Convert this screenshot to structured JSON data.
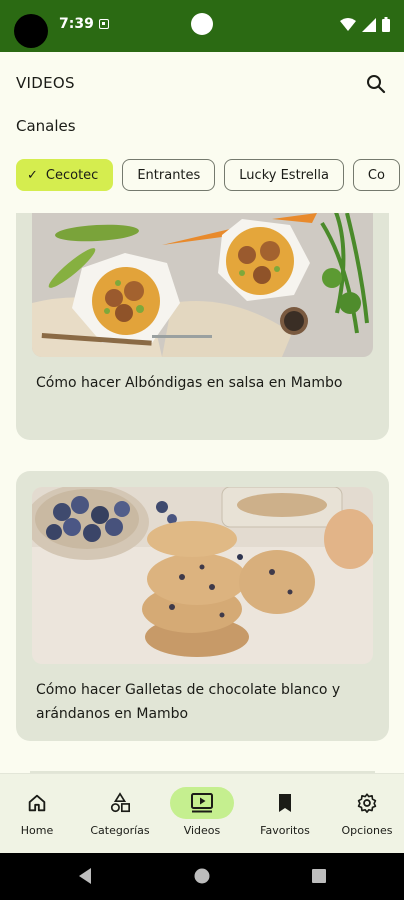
{
  "status_bar": {
    "time": "7:39"
  },
  "app_bar": {
    "title": "VIDEOS",
    "search_icon": "search-icon"
  },
  "channels": {
    "label": "Canales",
    "chips": [
      {
        "label": "Cecotec",
        "selected": true
      },
      {
        "label": "Entrantes",
        "selected": false
      },
      {
        "label": "Lucky Estrella",
        "selected": false
      },
      {
        "label": "Co",
        "selected": false
      }
    ]
  },
  "videos": [
    {
      "title": "Cómo hacer Albóndigas en salsa en Mambo"
    },
    {
      "title": "Cómo hacer Galletas de chocolate blanco y arándanos en Mambo"
    }
  ],
  "bottom_nav": {
    "items": [
      {
        "label": "Home",
        "icon": "home-icon"
      },
      {
        "label": "Categorías",
        "icon": "categories-icon"
      },
      {
        "label": "Videos",
        "icon": "video-icon",
        "active": true
      },
      {
        "label": "Favoritos",
        "icon": "bookmark-icon"
      },
      {
        "label": "Opciones",
        "icon": "settings-icon"
      }
    ]
  },
  "colors": {
    "status_bar": "#2b6a13",
    "chip_selected": "#d5ed4f",
    "card_bg": "#e1e5d6",
    "nav_active": "#c5ef8f",
    "background": "#fbfcf0"
  }
}
